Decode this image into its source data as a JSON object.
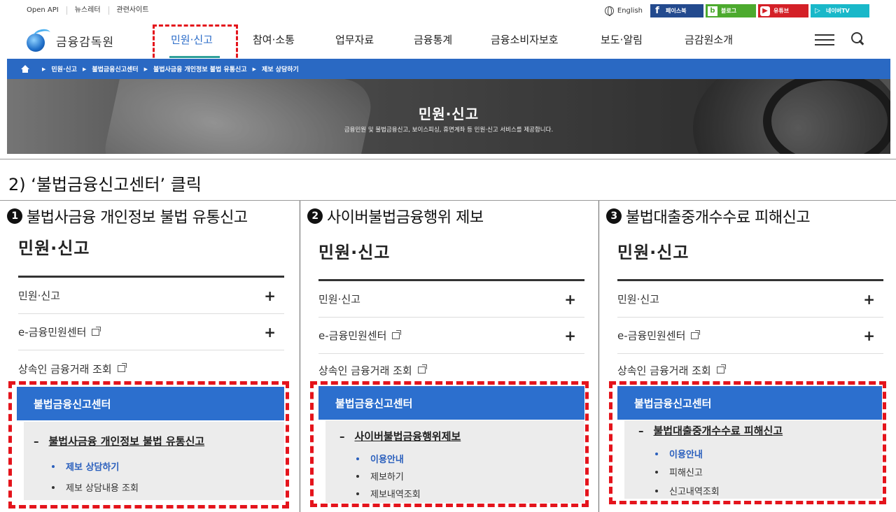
{
  "site": {
    "util_links": [
      "Open API",
      "뉴스레터",
      "관련사이트"
    ],
    "lang_label": "English",
    "sns": [
      {
        "icon": "f",
        "label": "페이스북",
        "color": "#234a8e"
      },
      {
        "icon": "b",
        "label": "블로그",
        "color": "#4caa2e"
      },
      {
        "icon": "▶",
        "label": "유튜브",
        "color": "#d42027"
      },
      {
        "icon": "▷",
        "label": "네이버TV",
        "color": "#19b8c9"
      }
    ],
    "logo_text": "금융감독원",
    "menu": [
      "민원·신고",
      "참여·소통",
      "업무자료",
      "금융통계",
      "금융소비자보호",
      "보도·알림",
      "금감원소개"
    ],
    "breadcrumb": [
      "민원·신고",
      "불법금융신고센터",
      "불법사금융 개인정보 불법 유통신고",
      "제보 상담하기"
    ],
    "hero_title": "민원·신고",
    "hero_subtitle": "금융민원 및 불법금융신고, 보이스피싱, 휴면계좌 등 민원·신고 서비스를 제공합니다.",
    "accent_color": "#2a69c3",
    "highlight_color": "#e4141c"
  },
  "step_text": "2) ‘불법금융신고센터’ 클릭",
  "panels": [
    {
      "num": "1",
      "title": "불법사금융 개인정보 불법 유통신고",
      "side_title": "민원·신고",
      "items": [
        "민원·신고",
        "e-금융민원센터",
        "상속인 금융거래 조회"
      ],
      "center_label": "불법금융신고센터",
      "sub_title": "불법사금융 개인정보 불법 유통신고",
      "links": [
        "제보 상담하기",
        "제보 상담내용 조회"
      ]
    },
    {
      "num": "2",
      "title": "사이버불법금융행위 제보",
      "side_title": "민원·신고",
      "items": [
        "민원·신고",
        "e-금융민원센터",
        "상속인 금융거래 조회"
      ],
      "center_label": "불법금융신고센터",
      "sub_title": "사이버불법금융행위제보",
      "links": [
        "이용안내",
        "제보하기",
        "제보내역조회"
      ]
    },
    {
      "num": "3",
      "title": "불법대출중개수수료  피해신고",
      "side_title": "민원·신고",
      "items": [
        "민원·신고",
        "e-금융민원센터",
        "상속인 금융거래 조회"
      ],
      "center_label": "불법금융신고센터",
      "sub_title": "불법대출중개수수료 피해신고",
      "links": [
        "이용안내",
        "피해신고",
        "신고내역조회"
      ]
    }
  ]
}
